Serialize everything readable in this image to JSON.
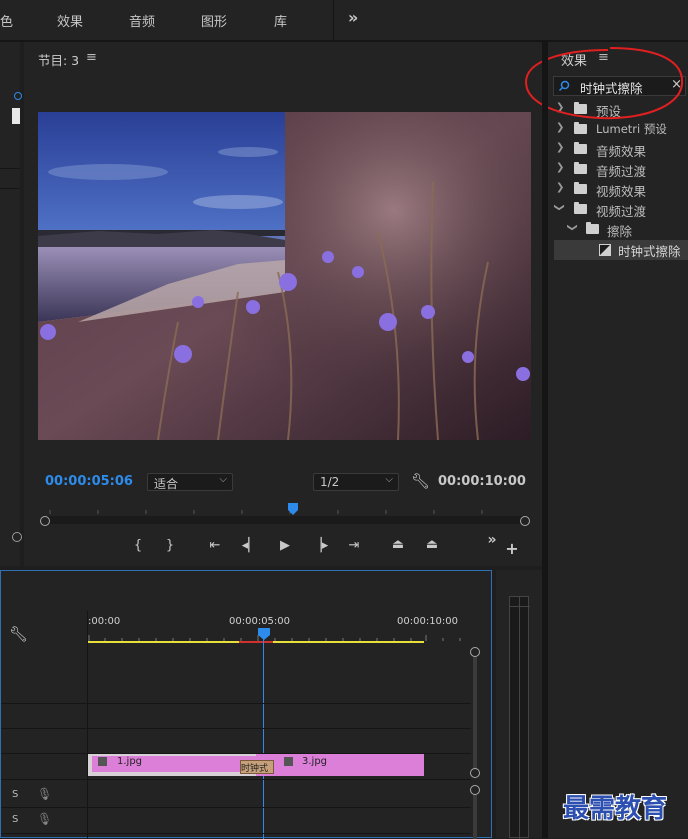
{
  "topbar": {
    "tabs": [
      "色",
      "效果",
      "音频",
      "图形",
      "库"
    ],
    "more": "»"
  },
  "program": {
    "title": "节目: 3",
    "menu": "≡",
    "current_timecode": "00:00:05:06",
    "fit_label": "适合",
    "resolution_label": "1/2",
    "duration_timecode": "00:00:10:00"
  },
  "effects": {
    "title": "效果",
    "menu": "≡",
    "search_value": "时钟式擦除",
    "clear": "×",
    "tree": [
      {
        "label": "预设",
        "expanded": false,
        "level": 0,
        "kind": "preset"
      },
      {
        "label": "Lumetri 预设",
        "expanded": false,
        "level": 0,
        "kind": "preset"
      },
      {
        "label": "音频效果",
        "expanded": false,
        "level": 0,
        "kind": "folder"
      },
      {
        "label": "音频过渡",
        "expanded": false,
        "level": 0,
        "kind": "folder"
      },
      {
        "label": "视频效果",
        "expanded": false,
        "level": 0,
        "kind": "folder"
      },
      {
        "label": "视频过渡",
        "expanded": true,
        "level": 0,
        "kind": "folder"
      },
      {
        "label": "擦除",
        "expanded": true,
        "level": 1,
        "kind": "folder"
      },
      {
        "label": "时钟式擦除",
        "level": 2,
        "kind": "effect",
        "selected": true
      }
    ]
  },
  "timeline": {
    "ruler": [
      ":00:00",
      "00:00:05:00",
      "00:00:10:00"
    ],
    "clips": [
      {
        "name": "1.jpg",
        "color": "#dc7fd8"
      },
      {
        "name": "3.jpg",
        "color": "#dc7fd8"
      }
    ],
    "transition_label": "时钟式",
    "track_labels": [
      "S",
      "S"
    ]
  },
  "watermark": "最需教育",
  "colors": {
    "accent": "#2d8ceb",
    "annotation": "#e02020",
    "clip": "#dc7fd8",
    "work_area": "#e8e03a"
  }
}
